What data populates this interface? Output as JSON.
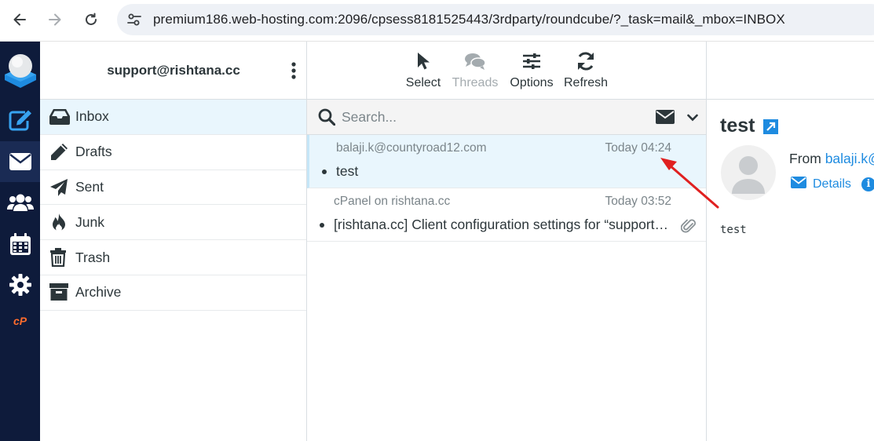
{
  "browser": {
    "url": "premium186.web-hosting.com:2096/cpsess8181525443/3rdparty/roundcube/?_task=mail&_mbox=INBOX"
  },
  "rail": {
    "items": [
      "logo",
      "compose",
      "mail",
      "contacts",
      "calendar",
      "settings",
      "cpanel"
    ],
    "cpanel_label": "cP"
  },
  "account": {
    "email": "support@rishtana.cc"
  },
  "folders": [
    {
      "label": "Inbox",
      "icon": "inbox-icon",
      "active": true
    },
    {
      "label": "Drafts",
      "icon": "pencil-icon"
    },
    {
      "label": "Sent",
      "icon": "paper-plane-icon"
    },
    {
      "label": "Junk",
      "icon": "fire-icon"
    },
    {
      "label": "Trash",
      "icon": "trash-icon"
    },
    {
      "label": "Archive",
      "icon": "archive-icon"
    }
  ],
  "toolbar": {
    "select_label": "Select",
    "threads_label": "Threads",
    "options_label": "Options",
    "refresh_label": "Refresh"
  },
  "search": {
    "placeholder": "Search..."
  },
  "messages": [
    {
      "from": "balaji.k@countyroad12.com",
      "date": "Today 04:24",
      "subject": "test",
      "selected": true
    },
    {
      "from": "cPanel on rishtana.cc",
      "date": "Today 03:52",
      "subject": "[rishtana.cc] Client configuration settings for “support…",
      "attachment": true
    }
  ],
  "preview": {
    "subject": "test",
    "from_label": "From",
    "from_address": "balaji.k@",
    "details_label": "Details",
    "info_label": "i",
    "body": "test"
  },
  "colors": {
    "rail": "#0e1b3b",
    "accent": "#1e8be0",
    "selected": "#e9f6fd",
    "annotation_arrow": "#e02020"
  }
}
